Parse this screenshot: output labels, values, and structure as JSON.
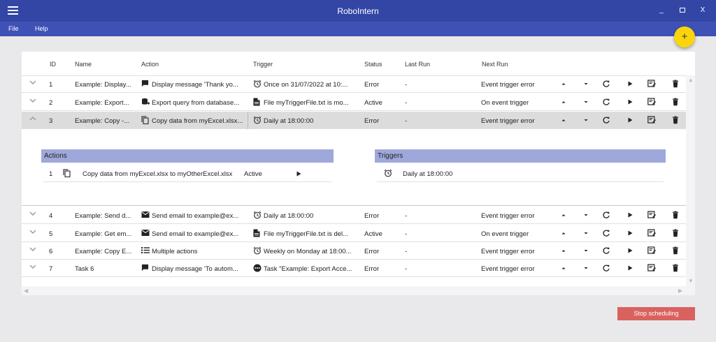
{
  "window": {
    "title": "RoboIntern",
    "minimize": "_",
    "close": "X"
  },
  "menu": [
    {
      "label": "File"
    },
    {
      "label": "Help"
    }
  ],
  "fab": {
    "label": "+"
  },
  "table": {
    "headers": {
      "id": "ID",
      "name": "Name",
      "action": "Action",
      "trigger": "Trigger",
      "status": "Status",
      "last_run": "Last Run",
      "next_run": "Next Run"
    },
    "rows": [
      {
        "id": "1",
        "name": "Example: Display...",
        "action_icon": "message-icon",
        "action": "Display message 'Thank yo...",
        "trigger_icon": "alarm-icon",
        "trigger": "Once on 31/07/2022 at 10:...",
        "status": "Error",
        "last_run": "-",
        "next_run": "Event trigger error"
      },
      {
        "id": "2",
        "name": "Example: Export...",
        "action_icon": "database-export-icon",
        "action": "Export query from database...",
        "trigger_icon": "file-icon",
        "trigger": "File myTriggerFile.txt is mo...",
        "status": "Active",
        "last_run": "-",
        "next_run": "On event trigger"
      },
      {
        "id": "3",
        "name": "Example: Copy -...",
        "action_icon": "copy-icon",
        "action": "Copy data from myExcel.xlsx...",
        "trigger_icon": "alarm-icon",
        "trigger": "Daily at 18:00:00",
        "status": "Error",
        "last_run": "-",
        "next_run": "Event trigger error"
      },
      {
        "id": "4",
        "name": "Example: Send d...",
        "action_icon": "email-icon",
        "action": "Send email to example@ex...",
        "trigger_icon": "alarm-icon",
        "trigger": "Daily at 18:00:00",
        "status": "Error",
        "last_run": "-",
        "next_run": "Event trigger error"
      },
      {
        "id": "5",
        "name": "Example: Get em...",
        "action_icon": "email-icon",
        "action": "Send email to example@ex...",
        "trigger_icon": "file-icon",
        "trigger": "File myTriggerFile.txt is del...",
        "status": "Active",
        "last_run": "-",
        "next_run": "On event trigger"
      },
      {
        "id": "6",
        "name": "Example: Copy E...",
        "action_icon": "list-icon",
        "action": "Multiple actions",
        "trigger_icon": "alarm-icon",
        "trigger": "Weekly on Monday at 18:00...",
        "status": "Error",
        "last_run": "-",
        "next_run": "Event trigger error"
      },
      {
        "id": "7",
        "name": "Task 6",
        "action_icon": "message-icon",
        "action": "Display message 'To autom...",
        "trigger_icon": "task-icon",
        "trigger": "Task \"Example: Export Acce...",
        "status": "Error",
        "last_run": "-",
        "next_run": "Event trigger error"
      }
    ],
    "expanded_row_index": 2
  },
  "detail": {
    "actions_title": "Actions",
    "triggers_title": "Triggers",
    "actions": [
      {
        "id": "1",
        "icon": "copy-icon",
        "text": "Copy data from myExcel.xlsx to myOtherExcel.xlsx",
        "status": "Active"
      }
    ],
    "triggers": [
      {
        "icon": "alarm-icon",
        "text": "Daily at 18:00:00"
      }
    ]
  },
  "footer": {
    "stop_label": "Stop scheduling"
  },
  "colors": {
    "titlebar": "#3346a5",
    "menubar": "#3f51b5",
    "fab": "#fbd50c",
    "section_header": "#9fa8da",
    "stop_button": "#d9625f",
    "expanded_row": "#dcdcdc"
  }
}
